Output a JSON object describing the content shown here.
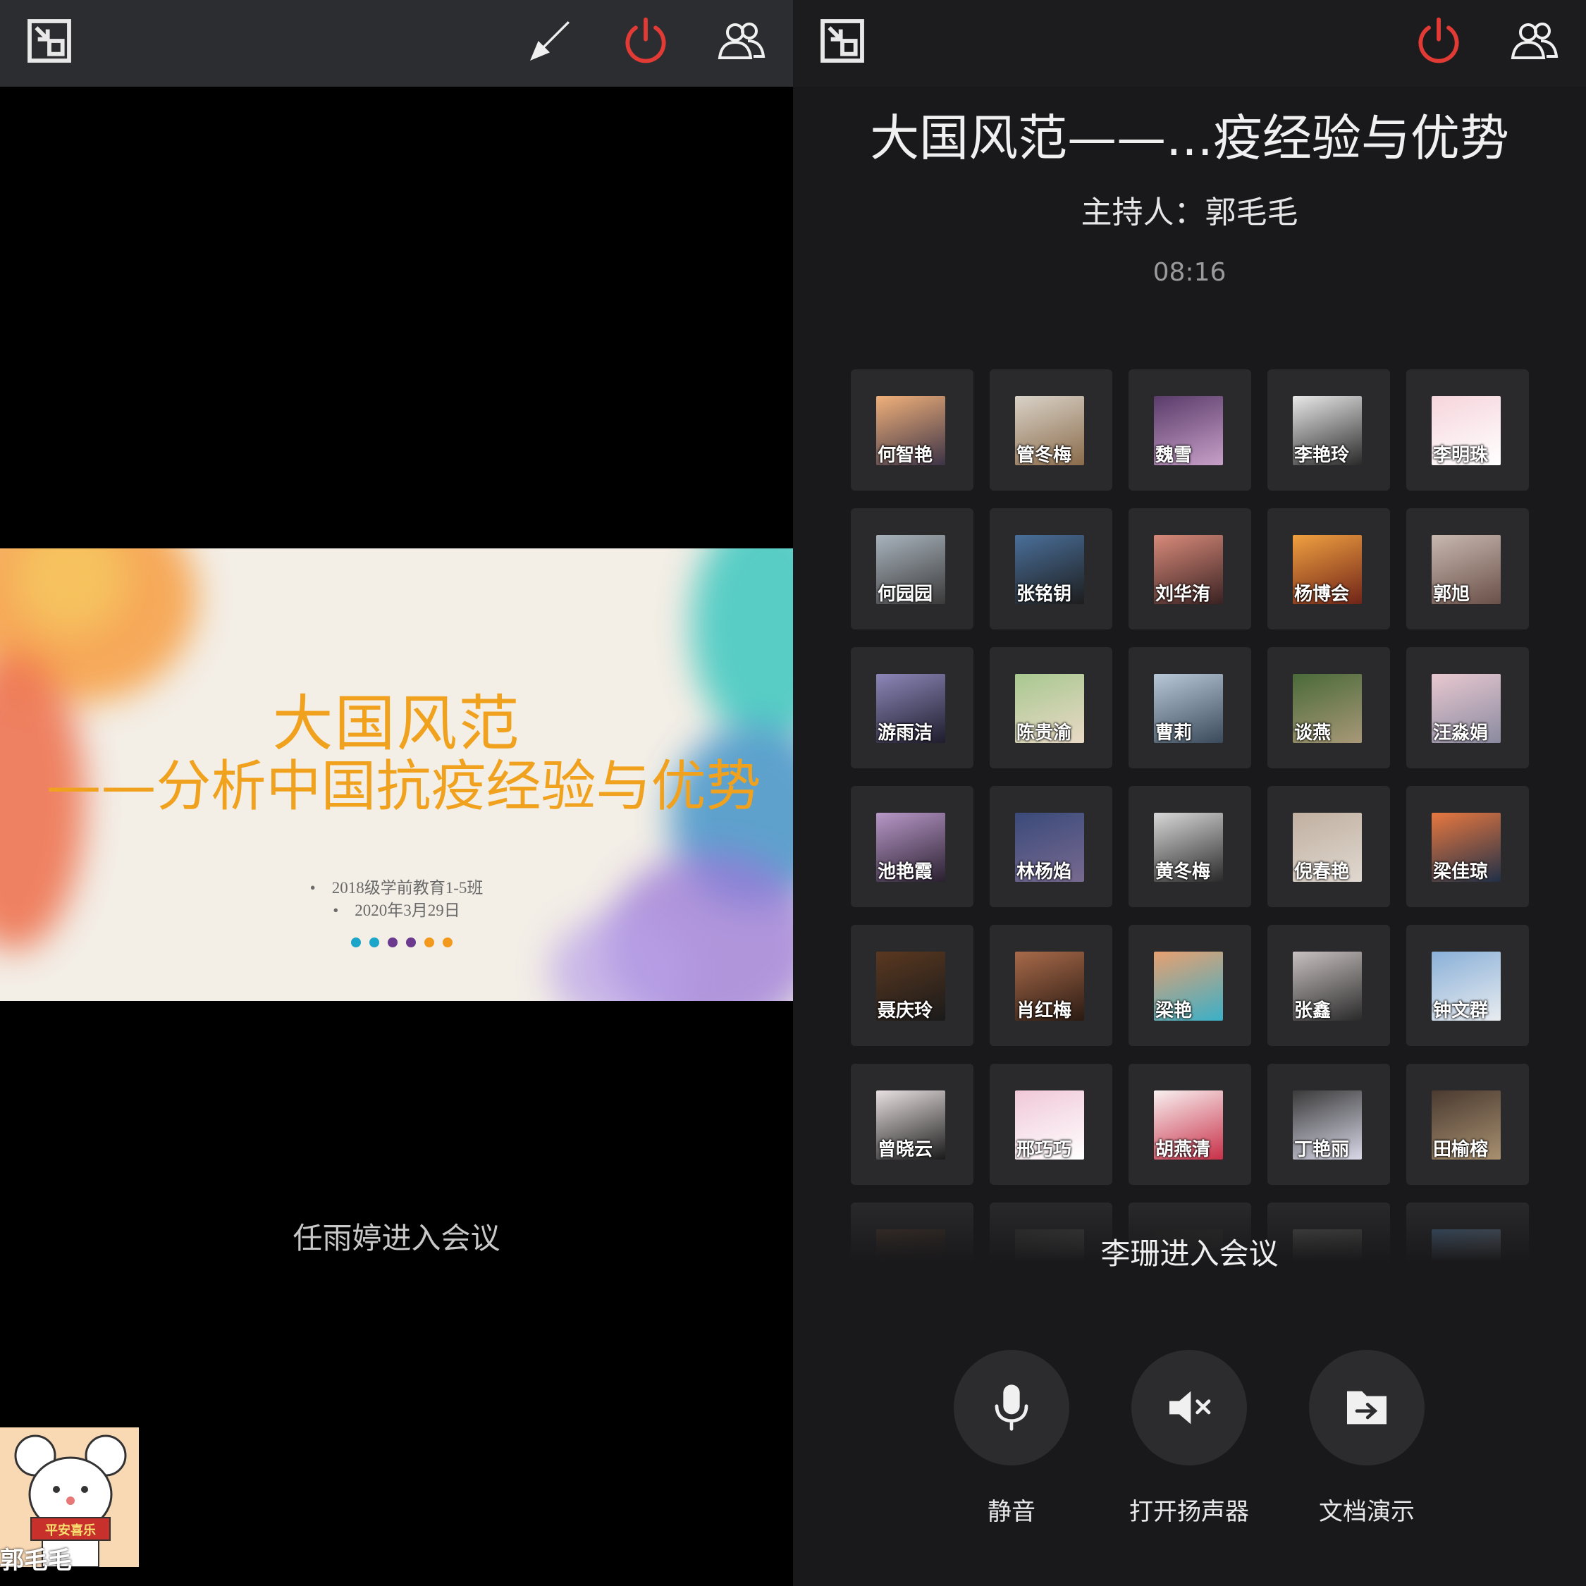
{
  "left": {
    "slide": {
      "title_line1": "大国风范",
      "title_line2": "——分析中国抗疫经验与优势",
      "bullet1": "2018级学前教育1-5班",
      "bullet2": "2020年3月29日",
      "dot_colors": [
        "#1ba5c8",
        "#1ba5c8",
        "#6b3a8f",
        "#6b3a8f",
        "#f39a1e",
        "#f39a1e"
      ]
    },
    "notice": "任雨婷进入会议",
    "self_name": "郭毛毛",
    "self_badge": "平安喜乐"
  },
  "right": {
    "meeting_title": "大国风范——...疫经验与优势",
    "host_line": "主持人：郭毛毛",
    "timer": "08:16",
    "notice": "李珊进入会议",
    "participants": [
      {
        "name": "何智艳",
        "c1": "#f0b07a",
        "c2": "#3c3346"
      },
      {
        "name": "管冬梅",
        "c1": "#d9d2c8",
        "c2": "#8a6b4a"
      },
      {
        "name": "魏雪",
        "c1": "#5a3b6a",
        "c2": "#c7a0c8"
      },
      {
        "name": "李艳玲",
        "c1": "#e8e8e8",
        "c2": "#2a2a2a"
      },
      {
        "name": "李明珠",
        "c1": "#f6d5dc",
        "c2": "#ffffff"
      },
      {
        "name": "何园园",
        "c1": "#a8b3bd",
        "c2": "#3b3a3a"
      },
      {
        "name": "张铭钥",
        "c1": "#4a6f9a",
        "c2": "#1d1d1d"
      },
      {
        "name": "刘华洧",
        "c1": "#d88a7a",
        "c2": "#3a2222"
      },
      {
        "name": "杨博会",
        "c1": "#f0a040",
        "c2": "#702418"
      },
      {
        "name": "郭旭",
        "c1": "#c8b8b0",
        "c2": "#6a5048"
      },
      {
        "name": "游雨洁",
        "c1": "#8c87b8",
        "c2": "#1e1c2c"
      },
      {
        "name": "陈贵渝",
        "c1": "#a8c890",
        "c2": "#e9d9c6"
      },
      {
        "name": "曹莉",
        "c1": "#b8c8d8",
        "c2": "#3a4a5a"
      },
      {
        "name": "谈燕",
        "c1": "#4a6a3a",
        "c2": "#a89878"
      },
      {
        "name": "汪淼娟",
        "c1": "#e8c8d0",
        "c2": "#8a8aa0"
      },
      {
        "name": "池艳霞",
        "c1": "#b898c8",
        "c2": "#2a2030"
      },
      {
        "name": "林杨焰",
        "c1": "#3a4a7a",
        "c2": "#786a90"
      },
      {
        "name": "黄冬梅",
        "c1": "#d8d8d8",
        "c2": "#2a2a2a"
      },
      {
        "name": "倪春艳",
        "c1": "#c0b0a0",
        "c2": "#e0d8d0"
      },
      {
        "name": "梁佳琼",
        "c1": "#e87840",
        "c2": "#203048"
      },
      {
        "name": "聂庆玲",
        "c1": "#5a3820",
        "c2": "#1a1a1a"
      },
      {
        "name": "肖红梅",
        "c1": "#a86a4a",
        "c2": "#2a1a12"
      },
      {
        "name": "梁艳",
        "c1": "#e8a070",
        "c2": "#3ab0c8"
      },
      {
        "name": "张鑫",
        "c1": "#c8c0c0",
        "c2": "#2a2a2a"
      },
      {
        "name": "钟文群",
        "c1": "#8ab0d8",
        "c2": "#e8ecf0"
      },
      {
        "name": "曾晓云",
        "c1": "#e8e0e0",
        "c2": "#1a1a1a"
      },
      {
        "name": "邢巧巧",
        "c1": "#f0c8d8",
        "c2": "#ffffff"
      },
      {
        "name": "胡燕清",
        "c1": "#f8f0f0",
        "c2": "#c83048"
      },
      {
        "name": "丁艳丽",
        "c1": "#3a3a3a",
        "c2": "#d8d8e8"
      },
      {
        "name": "田榆榕",
        "c1": "#4a3a30",
        "c2": "#a89070"
      },
      {
        "name": "",
        "c1": "#4a3a30",
        "c2": "#201a18"
      },
      {
        "name": "",
        "c1": "#3a3a38",
        "c2": "#6a6a68"
      },
      {
        "name": "",
        "c1": "#2a2a2a",
        "c2": "#4a4a48"
      },
      {
        "name": "",
        "c1": "#5a5a58",
        "c2": "#3a3a38"
      },
      {
        "name": "",
        "c1": "#4a6a8a",
        "c2": "#8a7060"
      }
    ],
    "controls": {
      "mute_label": "静音",
      "speaker_label": "打开扬声器",
      "doc_label": "文档演示"
    }
  }
}
